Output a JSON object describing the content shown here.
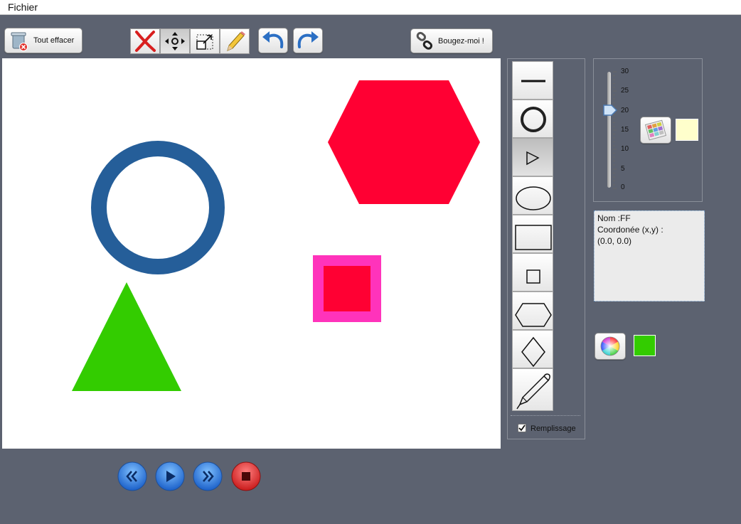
{
  "menu": {
    "file_label": "Fichier"
  },
  "toolbar": {
    "clear_all_label": "Tout effacer",
    "move_me_label": "Bougez-moi !",
    "tools": [
      "delete-tool",
      "move-tool",
      "resize-tool",
      "pencil-tool"
    ],
    "active_tool": "move-tool"
  },
  "shape_tools": {
    "items": [
      "line",
      "circle",
      "triangle",
      "ellipse",
      "rectangle",
      "square",
      "hexagon",
      "diamond",
      "pen"
    ],
    "active": "triangle",
    "fill_label": "Remplissage",
    "fill_checked": true
  },
  "stroke_slider": {
    "ticks": [
      "30",
      "25",
      "20",
      "15",
      "10",
      "5",
      "0"
    ],
    "value": 20,
    "max": 30,
    "stroke_color": "#ffffcc"
  },
  "info": {
    "name_line": "Nom :FF",
    "coord_label": "Coordonée (x,y) :",
    "coord_value": "(0.0, 0.0)"
  },
  "fill_color": "#33cc00",
  "canvas_shapes": [
    {
      "kind": "circle-outline",
      "color": "#255e99"
    },
    {
      "kind": "hexagon",
      "color": "#ff0033"
    },
    {
      "kind": "square-with-border",
      "fill": "#ff0033",
      "border": "#ff33bb"
    },
    {
      "kind": "triangle",
      "color": "#33cc00"
    }
  ],
  "playback": [
    "rewind",
    "play",
    "fast-forward",
    "stop"
  ]
}
